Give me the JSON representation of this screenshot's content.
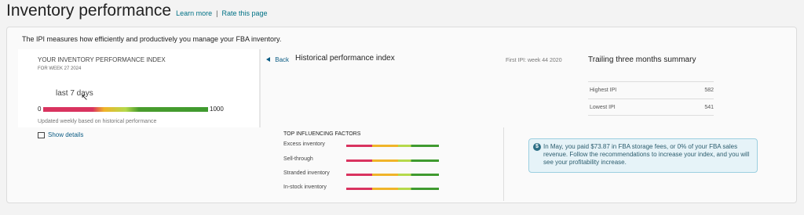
{
  "header": {
    "title": "Inventory performance",
    "learn_more": "Learn more",
    "separator": "|",
    "rate_page": "Rate this page"
  },
  "intro": "The IPI measures how efficiently and productively you manage your FBA inventory.",
  "ipi": {
    "title": "YOUR INVENTORY PERFORMANCE INDEX",
    "week": "FOR WEEK 27 2024",
    "period": "last 7 days",
    "min": "0",
    "max": "1000",
    "note": "Updated weekly based on historical performance",
    "show_details": "Show details"
  },
  "history": {
    "back": "Back",
    "title": "Historical performance index",
    "first_ipi": "First IPI: week 44 2020"
  },
  "trailing": {
    "title": "Trailing three months summary",
    "rows": [
      {
        "label": "Highest IPI",
        "value": "582"
      },
      {
        "label": "Lowest IPI",
        "value": "541"
      }
    ]
  },
  "factors": {
    "title": "TOP INFLUENCING FACTORS",
    "items": [
      {
        "label": "Excess inventory"
      },
      {
        "label": "Sell-through"
      },
      {
        "label": "Stranded inventory"
      },
      {
        "label": "In-stock inventory"
      }
    ]
  },
  "notice": {
    "icon": "dollar-icon",
    "text": "In May, you paid $73.87 in FBA storage fees, or 0% of your FBA sales revenue. Follow the recommendations to increase your index, and you will see your profitability increase."
  },
  "colors": {
    "link": "#007185",
    "poor": "#d9335f",
    "fair": "#f0b429",
    "good": "#b5d94b",
    "great": "#3f9a2f"
  }
}
